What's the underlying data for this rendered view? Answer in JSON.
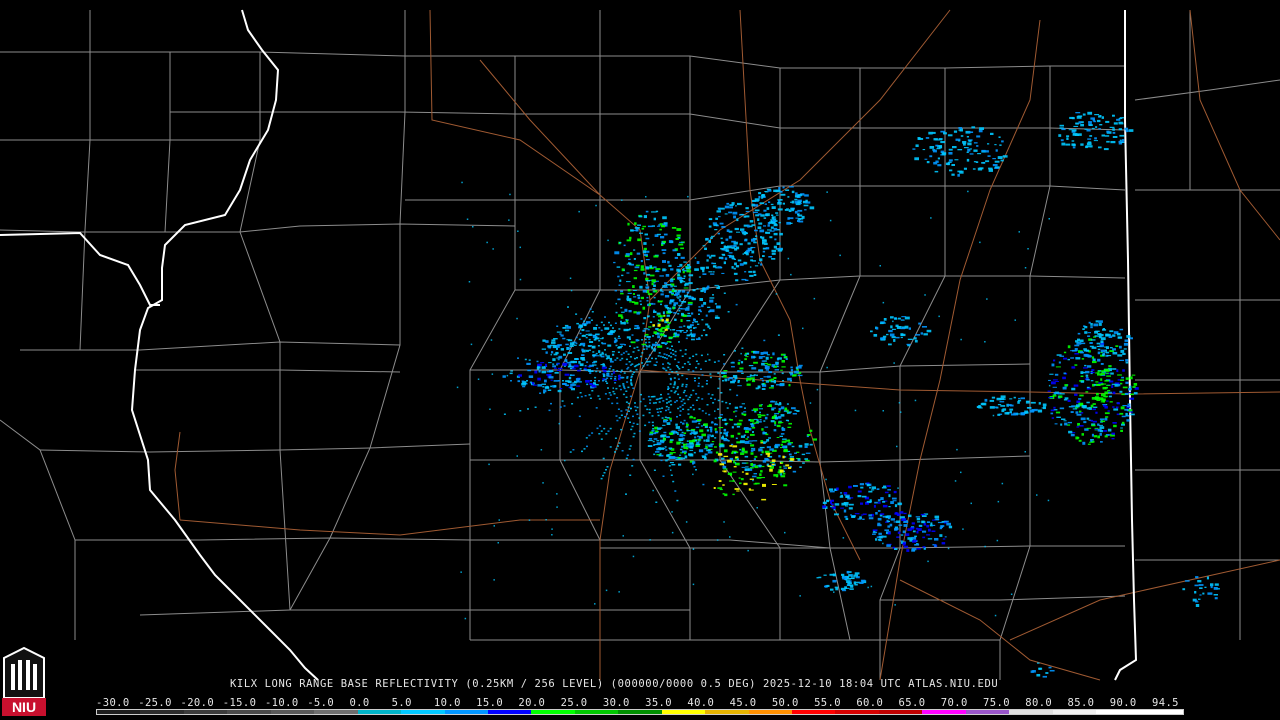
{
  "product": {
    "caption": "KILX LONG RANGE BASE REFLECTIVITY (0.25KM / 256 LEVEL) (000000/0000 0.5 DEG) 2025-12-10 18:04 UTC  ATLAS.NIU.EDU"
  },
  "scale": {
    "labels": [
      "-30.0",
      "-25.0",
      "-20.0",
      "-15.0",
      "-10.0",
      "-5.0",
      "0.0",
      "5.0",
      "10.0",
      "15.0",
      "20.0",
      "25.0",
      "30.0",
      "35.0",
      "40.0",
      "45.0",
      "50.0",
      "55.0",
      "60.0",
      "65.0",
      "70.0",
      "75.0",
      "80.0",
      "85.0",
      "90.0",
      "94.5"
    ],
    "colors": [
      "#1e1e1e",
      "#2d2d2d",
      "#3c3c3c",
      "#4b4b4b",
      "#5a5a5a",
      "#6e6e6e",
      "#00b4c8",
      "#00c8ff",
      "#0096ff",
      "#0000ff",
      "#00ff00",
      "#00c800",
      "#009000",
      "#ffff00",
      "#e6b400",
      "#ff9000",
      "#ff0000",
      "#d60000",
      "#c00000",
      "#ff00ff",
      "#9955c9",
      "#e0e0e0",
      "#f0f0f0",
      "#ffffff",
      "#ffffff"
    ]
  },
  "map": {
    "state_border_color": "#ffffff",
    "county_border_color": "#8c8c8c",
    "highway_color": "#a05a32",
    "echo_colors": {
      "light": "#00c8ff",
      "medium": "#0096ff",
      "heavy": "#0000ff",
      "moderate": "#00ff00",
      "strong": "#ffff00"
    }
  },
  "logo": {
    "text": "NIU",
    "color": "#c8102e"
  }
}
